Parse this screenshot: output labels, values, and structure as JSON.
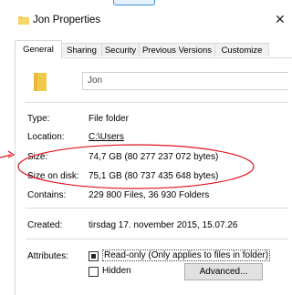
{
  "window": {
    "title": "Jon Properties",
    "close_glyph": "✕"
  },
  "tabs": [
    {
      "label": "General",
      "active": true
    },
    {
      "label": "Sharing",
      "active": false
    },
    {
      "label": "Security",
      "active": false
    },
    {
      "label": "Previous Versions",
      "active": false
    },
    {
      "label": "Customize",
      "active": false
    }
  ],
  "general": {
    "name_value": "Jon",
    "rows": [
      {
        "label": "Type:",
        "value": "File folder"
      },
      {
        "label": "Location:",
        "value": "C:\\Users"
      },
      {
        "label": "Size:",
        "value": "74,7 GB (80 277 237 072 bytes)"
      },
      {
        "label": "Size on disk:",
        "value": "75,1 GB (80 737 435 648 bytes)"
      },
      {
        "label": "Contains:",
        "value": "229 800 Files, 36 930 Folders"
      },
      {
        "label": "Created:",
        "value": "tirsdag 17. november 2015, 15.07.26"
      }
    ],
    "attributes_label": "Attributes:",
    "readonly_label": "Read-only (Only applies to files in folder)",
    "hidden_label": "Hidden",
    "advanced_button": "Advanced..."
  },
  "colors": {
    "annotation_red": "#e0141e",
    "folder_yellow": "#f2c94c",
    "tab_border": "#d9d9d9"
  },
  "icons": {
    "title": "folder-icon",
    "name": "folder-icon",
    "close": "close-icon"
  }
}
